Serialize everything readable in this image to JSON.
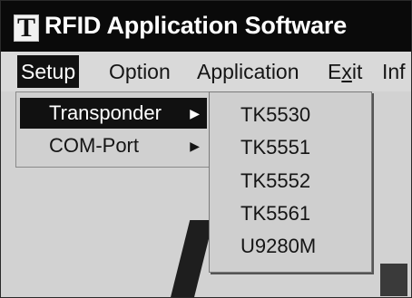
{
  "window": {
    "icon_letter": "T",
    "title": "RFID Application Software"
  },
  "menubar": {
    "items": [
      {
        "label": "Setup"
      },
      {
        "label": "Option"
      },
      {
        "label": "Application"
      },
      {
        "label_pre": "E",
        "mnemonic": "x",
        "label_post": "it"
      },
      {
        "label": "Inf"
      }
    ]
  },
  "setup_menu": {
    "items": [
      {
        "label": "Transponder",
        "arrow": "▶"
      },
      {
        "label": "COM-Port",
        "arrow": "▶"
      }
    ]
  },
  "transponder_submenu": {
    "items": [
      {
        "label": "TK5530"
      },
      {
        "label": "TK5551"
      },
      {
        "label": "TK5552"
      },
      {
        "label": "TK5561"
      },
      {
        "label": "U9280M"
      }
    ]
  },
  "colors": {
    "title_bar": "#0a0a0a",
    "menu_bg": "#d9d9d9",
    "highlight": "#111111",
    "highlight_text": "#ffffff"
  },
  "icons": {
    "app_icon": "app-logo-icon",
    "submenu_arrow": "arrow-right-icon"
  }
}
